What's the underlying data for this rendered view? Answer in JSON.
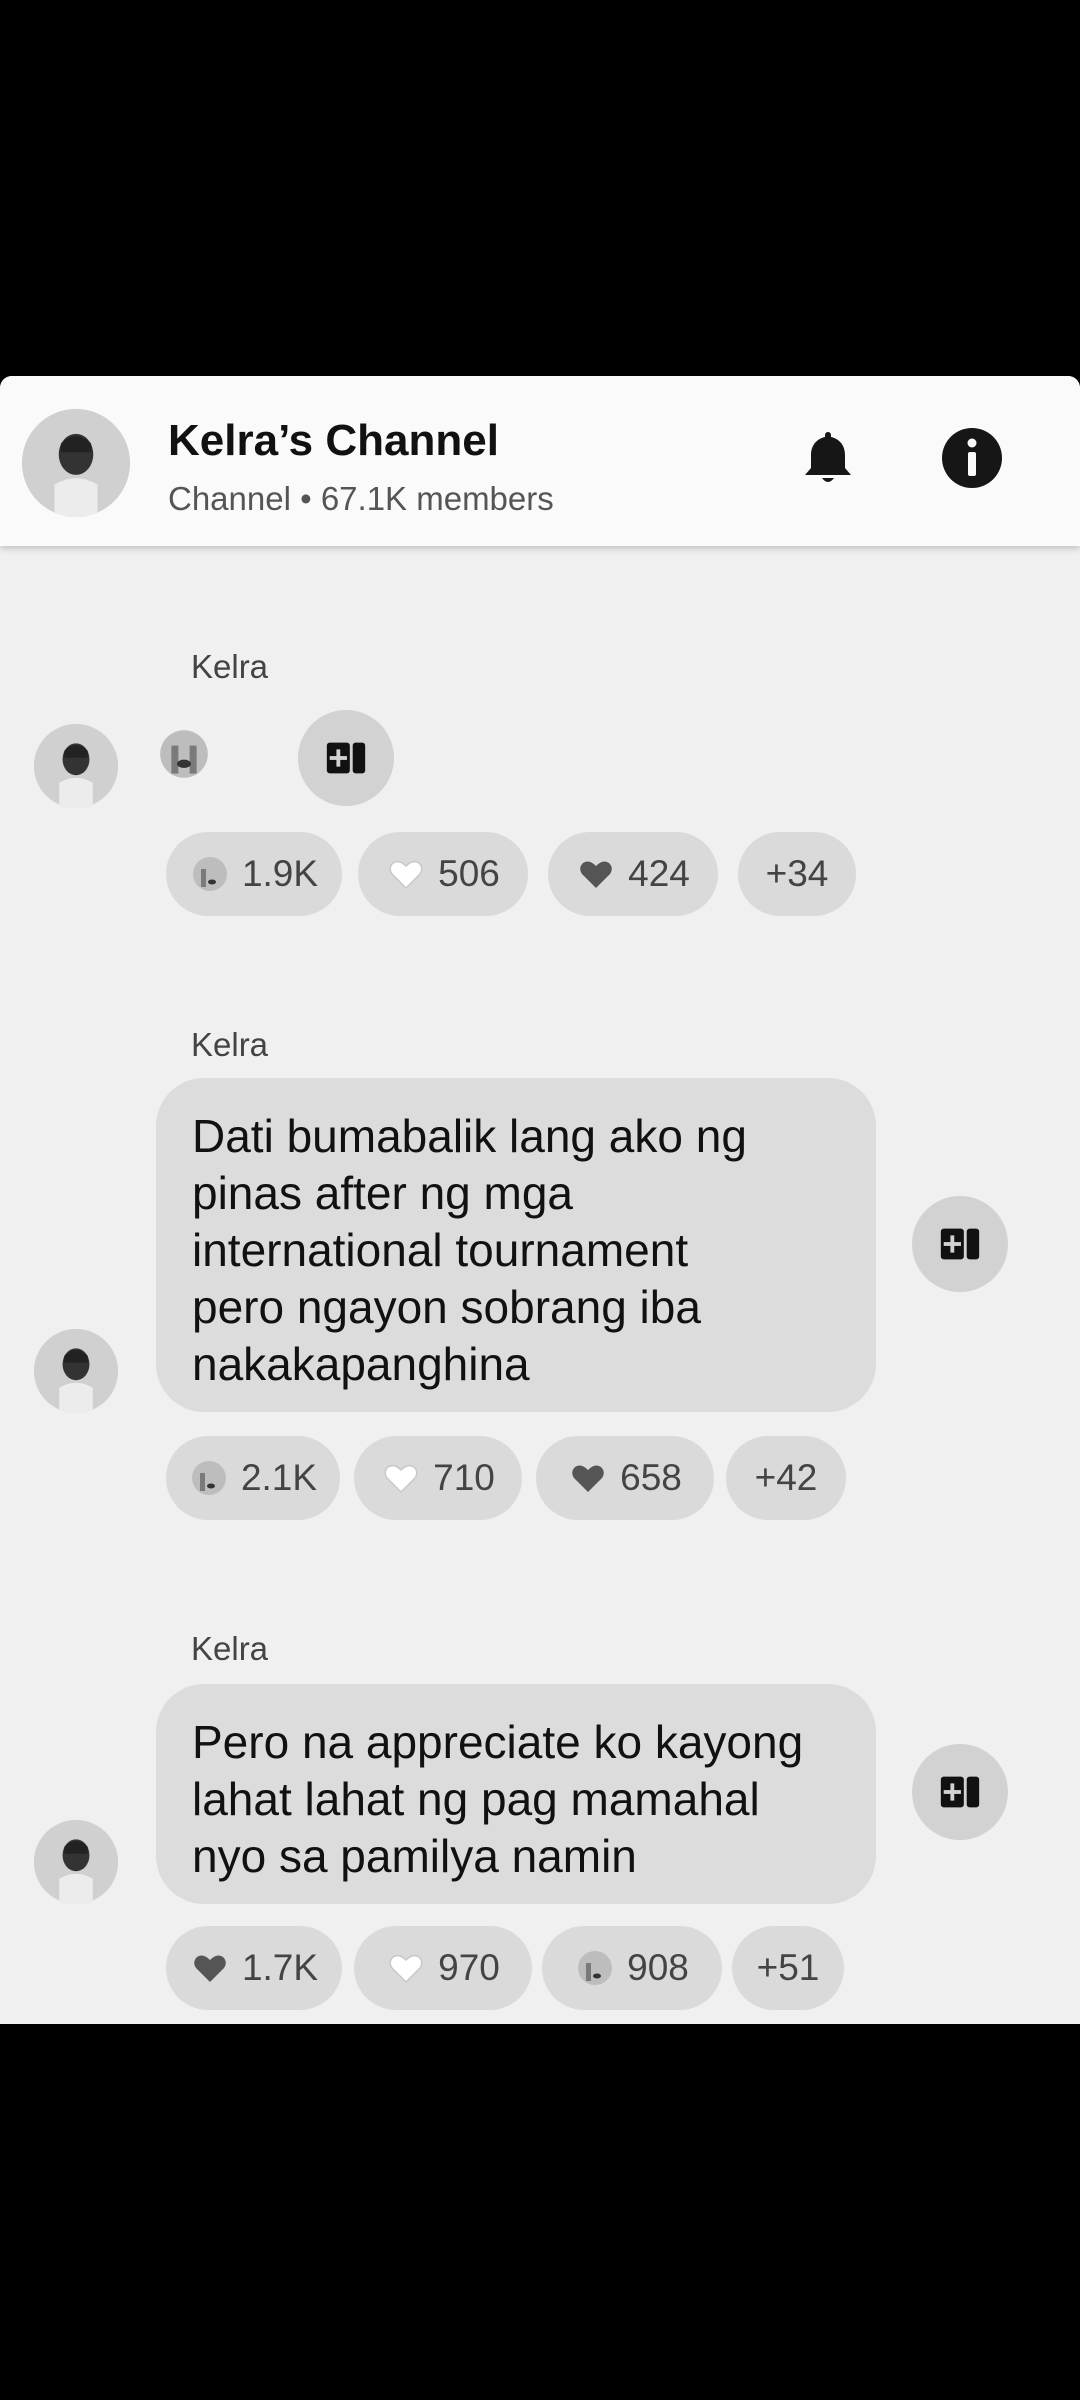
{
  "header": {
    "title": "Kelra’s Channel",
    "subtitle": "Channel • 67.1K members",
    "icons": [
      "avatar",
      "bell-icon",
      "info-icon"
    ]
  },
  "messages": [
    {
      "sender": "Kelra",
      "content": "",
      "emoji": "crying-face-emoji",
      "reactions": [
        {
          "icon": "crying-face",
          "count": "1.9K"
        },
        {
          "icon": "white-heart",
          "count": "506"
        },
        {
          "icon": "dark-heart",
          "count": "424"
        },
        {
          "icon": "",
          "count": "+34"
        }
      ]
    },
    {
      "sender": "Kelra",
      "content": "Dati bumabalik lang ako ng pinas after ng mga international tournament pero ngayon sobrang iba nakakapanghina",
      "lines": [
        "Dati bumabalik lang ako ng",
        "pinas after ng mga",
        "international tournament",
        "pero ngayon sobrang iba",
        "nakakapanghina"
      ],
      "reactions": [
        {
          "icon": "crying-face",
          "count": "2.1K"
        },
        {
          "icon": "white-heart",
          "count": "710"
        },
        {
          "icon": "dark-heart",
          "count": "658"
        },
        {
          "icon": "",
          "count": "+42"
        }
      ]
    },
    {
      "sender": "Kelra",
      "content": "Pero na appreciate ko kayong lahat lahat ng pag mamahal nyo sa pamilya namin",
      "lines": [
        "Pero na appreciate ko kayong",
        "lahat lahat ng pag mamahal",
        "nyo sa pamilya namin"
      ],
      "reactions": [
        {
          "icon": "dark-heart",
          "count": "1.7K"
        },
        {
          "icon": "white-heart",
          "count": "970"
        },
        {
          "icon": "crying-face",
          "count": "908"
        },
        {
          "icon": "",
          "count": "+51"
        }
      ]
    }
  ]
}
